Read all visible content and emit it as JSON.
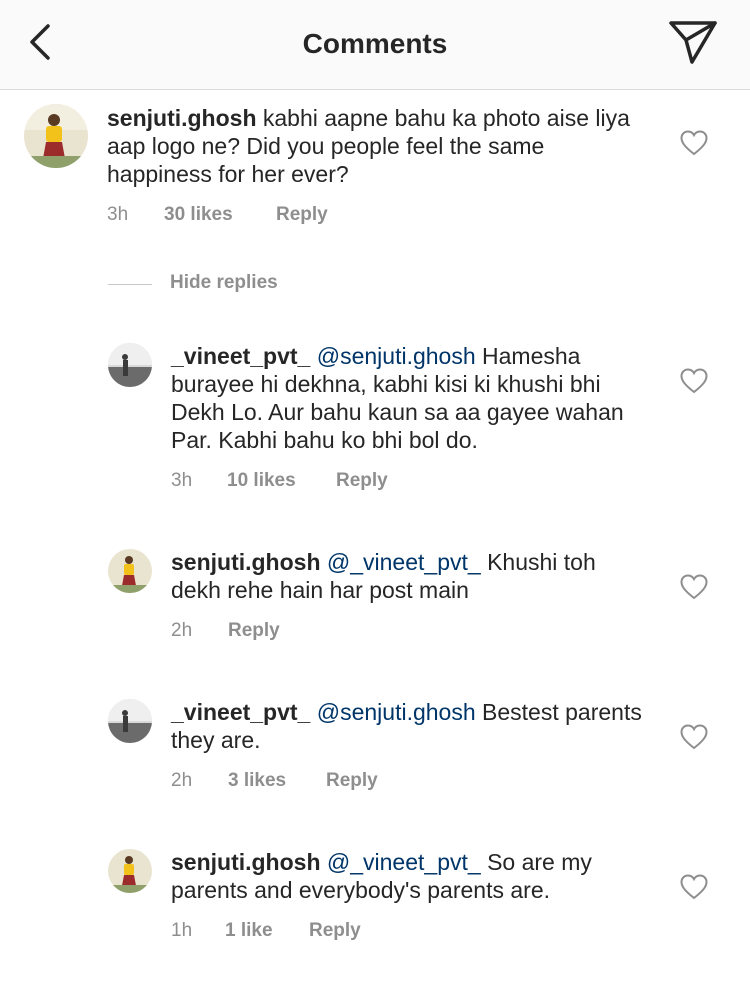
{
  "header": {
    "title": "Comments",
    "back_icon": "chevron-left-icon",
    "send_icon": "paper-plane-icon"
  },
  "hide_replies_label": "Hide replies",
  "comments": [
    {
      "username": "senjuti.ghosh",
      "mention": "",
      "text": "kabhi aapne bahu ka photo aise liya aap logo ne? Did you people feel the same happiness for her ever?",
      "time": "3h",
      "likes": "30 likes",
      "reply": "Reply"
    },
    {
      "username": "_vineet_pvt_",
      "mention": "@senjuti.ghosh",
      "text": "Hamesha burayee hi dekhna,  kabhi kisi ki khushi bhi Dekh Lo.  Aur bahu kaun sa aa gayee wahan Par.  Kabhi bahu ko bhi bol do.",
      "time": "3h",
      "likes": "10 likes",
      "reply": "Reply"
    },
    {
      "username": "senjuti.ghosh",
      "mention": "@_vineet_pvt_",
      "text": "Khushi toh dekh rehe hain har post main",
      "time": "2h",
      "likes": "",
      "reply": "Reply"
    },
    {
      "username": "_vineet_pvt_",
      "mention": "@senjuti.ghosh",
      "text": "Bestest parents they are.",
      "time": "2h",
      "likes": "3 likes",
      "reply": "Reply"
    },
    {
      "username": "senjuti.ghosh",
      "mention": "@_vineet_pvt_",
      "text": "So are my parents and everybody's parents are.",
      "time": "1h",
      "likes": "1 like",
      "reply": "Reply"
    }
  ],
  "colors": {
    "text": "#262626",
    "secondary": "#8e8e8e",
    "mention": "#003569",
    "header_bg": "#fafafa",
    "divider": "#dbdbdb"
  }
}
